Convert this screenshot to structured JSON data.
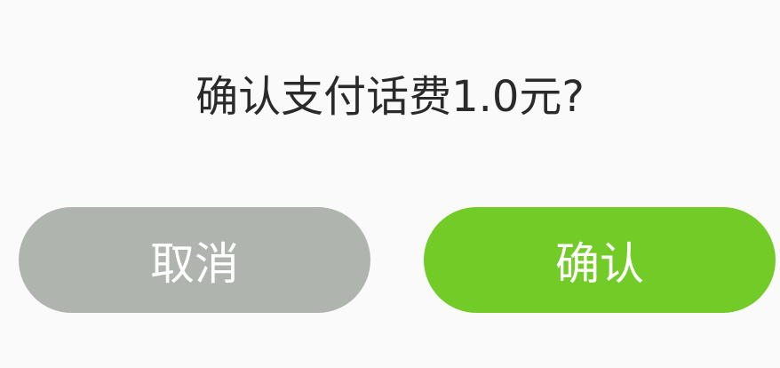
{
  "dialog": {
    "message": "确认支付话费1.0元?",
    "cancel_label": "取消",
    "confirm_label": "确认"
  },
  "colors": {
    "background": "#fafafa",
    "cancel_button": "#b0b4ae",
    "confirm_button": "#73cb27",
    "message_text": "#2a2a2a"
  }
}
